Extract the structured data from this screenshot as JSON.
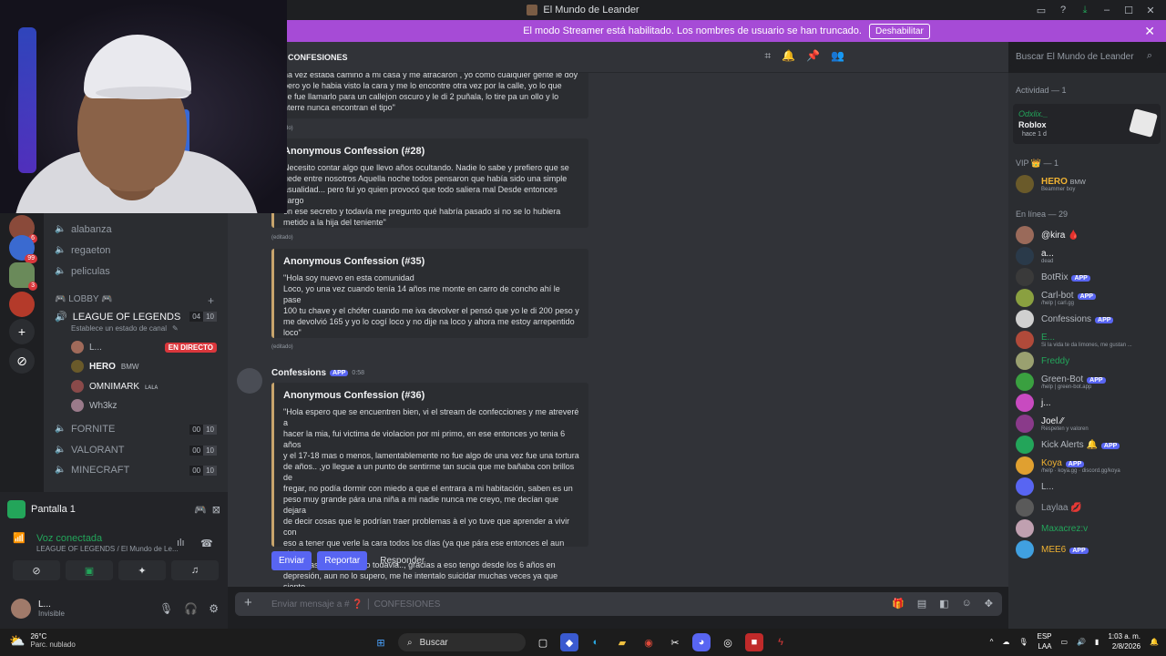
{
  "window": {
    "title": "El Mundo de Leander"
  },
  "banner": {
    "text": "El modo Streamer está habilitado. Los nombres de usuario se han truncado.",
    "button": "Deshabilitar"
  },
  "channel_header": {
    "name": "CONFESIONES"
  },
  "search": {
    "placeholder": "Buscar El Mundo de Leander"
  },
  "sidebar": {
    "server_badges": [
      "6",
      "99",
      "3"
    ],
    "text_channels": [
      "alabanza",
      "regaeton",
      "peliculas"
    ],
    "category": "LOBBY",
    "voice_main": {
      "name": "LEAGUE OF LEGENDS",
      "count": [
        "04",
        "10"
      ],
      "status": "Establece un estado de canal"
    },
    "voice_users": [
      {
        "name": "L...",
        "live": "EN DIRECTO"
      },
      {
        "name": "HERO",
        "tag": "BMW"
      },
      {
        "name": "OMNIMARK",
        "tag": "ʟᴀʟᴀ"
      },
      {
        "name": "Wh3kz"
      }
    ],
    "voice_channels": [
      {
        "name": "FORNITE",
        "count": [
          "00",
          "10"
        ]
      },
      {
        "name": "VALORANT",
        "count": [
          "00",
          "10"
        ]
      },
      {
        "name": "MINECRAFT",
        "count": [
          "00",
          "10"
        ]
      }
    ]
  },
  "voice_panel": {
    "screen": "Pantalla 1",
    "status": "Voz conectada",
    "location": "LEAGUE OF LEGENDS / El Mundo de Le..."
  },
  "user_panel": {
    "name": "L...",
    "status": "Invisible"
  },
  "messages": [
    {
      "type": "embed",
      "lines": "na vez estaba camino a mi casa y me atracaron , yo como cualquier gente le doy\n pero yo le habia visto la cara y me lo encontre otra vez por la calle, yo lo que\nce fue llamarlo para un callejon oscuro y le di 2 puñala, lo tire pa un ollo y lo\nnterre nunca encontran el tipo\"",
      "edited": "(editado)"
    },
    {
      "type": "embed",
      "title": "Anonymous Confession (#28)",
      "lines": "Necesito contar algo que llevo años ocultando. Nadie lo sabe y prefiero que se\nuede entre nosotros Aquella noche todos pensaron que había sido una simple\nasualidad... pero fui yo quien provocó que todo saliera mal Desde entonces cargo\non ese secreto y todavía me pregunto qué habría pasado si no se lo hubiera\nmetido a la hija del teniente\"",
      "edited": "(editado)"
    },
    {
      "type": "embed",
      "title": "Anonymous Confession (#35)",
      "lines": "\"Hola soy nuevo en esta comunidad\nLoco, yo una vez cuando tenía 14 años me monte en carro de concho ahí le pase\n100 tu chave y el chófer cuando me iva devolver el pensó que yo le di 200 peso y\nme devolvió 165 y yo lo cogí loco y no dije na loco y ahora me estoy arrepentido\nloco\"",
      "edited": "(editado)"
    },
    {
      "type": "message",
      "author": "Confessions",
      "tag": "APP",
      "time": "0:58",
      "title": "Anonymous Confession (#36)",
      "lines": "\"Hola espero que se encuentren bien, vi el stream de confecciones y me atreveré a\nhacer la mia, fui victima de violacion por mi primo, en ese entonces yo tenia 6 años\ny el 17-18 mas o menos, lamentablemente no fue algo de una vez fue una tortura\nde años.. ,yo llegue a un punto de sentirme tan sucia que me bañaba con brillos de\nfregar, no podía dormir con miedo a que el entrara a mi habitación, saben es un\npeso muy grande pára una niña a mi nadie nunca me creyo, me decían que dejara\nde decir cosas que le podrían traer problemas à el yo tuve que aprender a vivir con\neso a tener que verle la cara todos los días (ya que pára ese entonces el aun vivia\nen mi casa) me da asco todavia.., gracias a eso tengo desde los 6 años en\ndepresión, aun no lo supero, me he intentalo suicidar muchas veces ya que siento\nque esto es demasiado pára mi, realmente aveces me pongo a pensar como\nalguien puede ser tan asqueroso pára hacerle algo a una NIÑA.\"",
      "buttons": [
        "Enviar",
        "Reportar",
        "Responder"
      ]
    }
  ],
  "composer": {
    "placeholder": "Enviar mensaje a #  ❓ │  CONFESIONES"
  },
  "members": {
    "activity_header": "Actividad — 1",
    "activity": {
      "user": "Odxlix._",
      "game": "Roblox",
      "when": "hace 1 d"
    },
    "vip_header": "VIP 👑 — 1",
    "vip": [
      {
        "name": "HERO",
        "tag": "BMW",
        "status": "Beammer boy"
      }
    ],
    "online_header": "En línea — 29",
    "online": [
      {
        "name": "@kira 🩸",
        "status": "",
        "color": "#f2f3f5"
      },
      {
        "name": "a...",
        "status": "dead",
        "color": "#f2f3f5"
      },
      {
        "name": "BotRix",
        "app": "APP",
        "status": "",
        "color": "#b5bac1"
      },
      {
        "name": "Carl-bot",
        "app": "APP",
        "status": "/help | carl.gg",
        "color": "#b5bac1"
      },
      {
        "name": "Confessions",
        "app": "APP",
        "status": "",
        "color": "#b5bac1"
      },
      {
        "name": "E...",
        "status": "Si la vida te da limones, me gustan ...",
        "color": "#23a55a"
      },
      {
        "name": "Freddy",
        "status": "",
        "color": "#23a55a"
      },
      {
        "name": "Green-Bot",
        "app": "APP",
        "status": "/help | green-bot.app",
        "color": "#b5bac1"
      },
      {
        "name": "j...",
        "status": "",
        "color": "#f2f3f5"
      },
      {
        "name": "Joel ⁄⁄",
        "status": "Respeten y valoren",
        "color": "#f2f3f5"
      },
      {
        "name": "Kick Alerts 🔔",
        "app": "APP",
        "status": "",
        "color": "#b5bac1"
      },
      {
        "name": "Koya",
        "app": "APP",
        "status": "/help · koya.gg · discord.gg/koya",
        "color": "#f0b232"
      },
      {
        "name": "L...",
        "status": "",
        "color": "#b5bac1"
      },
      {
        "name": "Laylaa 💋",
        "status": "",
        "color": "#949ba4"
      },
      {
        "name": "Maxacrez:v",
        "status": "",
        "color": "#23a55a"
      },
      {
        "name": "MEE6",
        "app": "APP",
        "status": "",
        "color": "#f0b232"
      }
    ]
  },
  "taskbar": {
    "weather_temp": "26°C",
    "weather_desc": "Parc. nublado",
    "search": "Buscar",
    "lang": "ESP",
    "lang_sub": "LAA",
    "time": "1:03 a. m.",
    "date": "2/8/2026"
  }
}
